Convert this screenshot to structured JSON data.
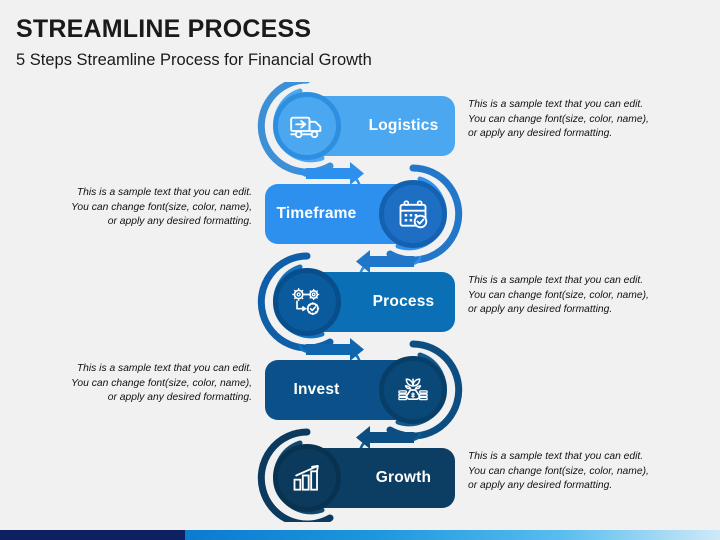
{
  "header": {
    "title": "STREAMLINE PROCESS",
    "subtitle": "5 Steps Streamline Process for Financial Growth"
  },
  "description_text": {
    "line1": "This is a sample text that you can edit.",
    "line2": "You can change font(size, color, name),",
    "line3": "or apply any desired formatting."
  },
  "colors": {
    "background": "#f1f1f1",
    "title": "#1a1a1a",
    "step1": "#4BA8F0",
    "step1_circle": "#4BA8F0",
    "step1_arc": "#3D8FD6",
    "step2": "#2E90EE",
    "step2_circle": "#1E6FC4",
    "step2_arc": "#2277C9",
    "step3": "#0A6FB5",
    "step3_circle": "#0A5A9E",
    "step3_arc": "#0F5FA8",
    "step4": "#0B5089",
    "step4_circle": "#0A4878",
    "step4_arc": "#0D4E82",
    "step5": "#0C3E63",
    "step5_circle": "#0B3A5C",
    "step5_arc": "#0C3A5E",
    "connector": "#2E90EE",
    "footer_left": "#0E2060",
    "footer_mid": "#0B7BD0",
    "footer_right": "#CFE9F8"
  },
  "steps": [
    {
      "id": "logistics",
      "label": "Logistics",
      "icon": "truck-icon",
      "side": "right",
      "color": "#4BA8F0"
    },
    {
      "id": "timeframe",
      "label": "Timeframe",
      "icon": "calendar-check-icon",
      "side": "left",
      "color": "#2E90EE"
    },
    {
      "id": "process",
      "label": "Process",
      "icon": "gears-icon",
      "side": "right",
      "color": "#0A6FB5"
    },
    {
      "id": "invest",
      "label": "Invest",
      "icon": "money-plant-icon",
      "side": "left",
      "color": "#0B5089"
    },
    {
      "id": "growth",
      "label": "Growth",
      "icon": "bar-chart-growth-icon",
      "side": "right",
      "color": "#0C3E63"
    }
  ]
}
